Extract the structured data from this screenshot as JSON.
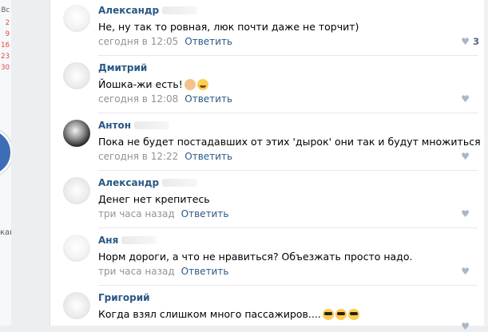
{
  "calendar": {
    "weekday": "Вс",
    "days": [
      "2",
      "9",
      "16",
      "23",
      "30"
    ]
  },
  "left_fragment_text": "кам",
  "comments": [
    {
      "author": "Александр",
      "text": "Не, ну так то ровная, люк почти даже не торчит)",
      "time": "сегодня в 12:05",
      "reply": "Ответить",
      "likes": "3",
      "emoji": []
    },
    {
      "author": "Дмитрий",
      "text": "Йошка-жи есть!",
      "time": "сегодня в 12:08",
      "reply": "Ответить",
      "likes": "",
      "emoji": [
        "ok-hand",
        "rofl-face"
      ]
    },
    {
      "author": "Антон",
      "text": "Пока не будет постадавших от этих 'дырок' они так и будут множиться",
      "time": "сегодня в 12:22",
      "reply": "Ответить",
      "likes": "",
      "emoji": []
    },
    {
      "author": "Александр",
      "text": "Денег нет крепитесь",
      "time": "три часа назад",
      "reply": "Ответить",
      "likes": "",
      "emoji": []
    },
    {
      "author": "Аня",
      "text": "Норм дороги, а что не нравиться? Объезжать просто надо.",
      "time": "три часа назад",
      "reply": "Ответить",
      "likes": "",
      "emoji": []
    },
    {
      "author": "Григорий",
      "text": "Когда взял слишком много пассажиров....",
      "time": "",
      "reply": "",
      "likes": "",
      "emoji": [
        "sunglasses-face",
        "sunglasses-face",
        "sunglasses-face"
      ]
    }
  ],
  "icons": {
    "like": "heart-icon"
  },
  "colors": {
    "link": "#2a5885",
    "meta": "#939393",
    "like": "#a8b6c8"
  }
}
